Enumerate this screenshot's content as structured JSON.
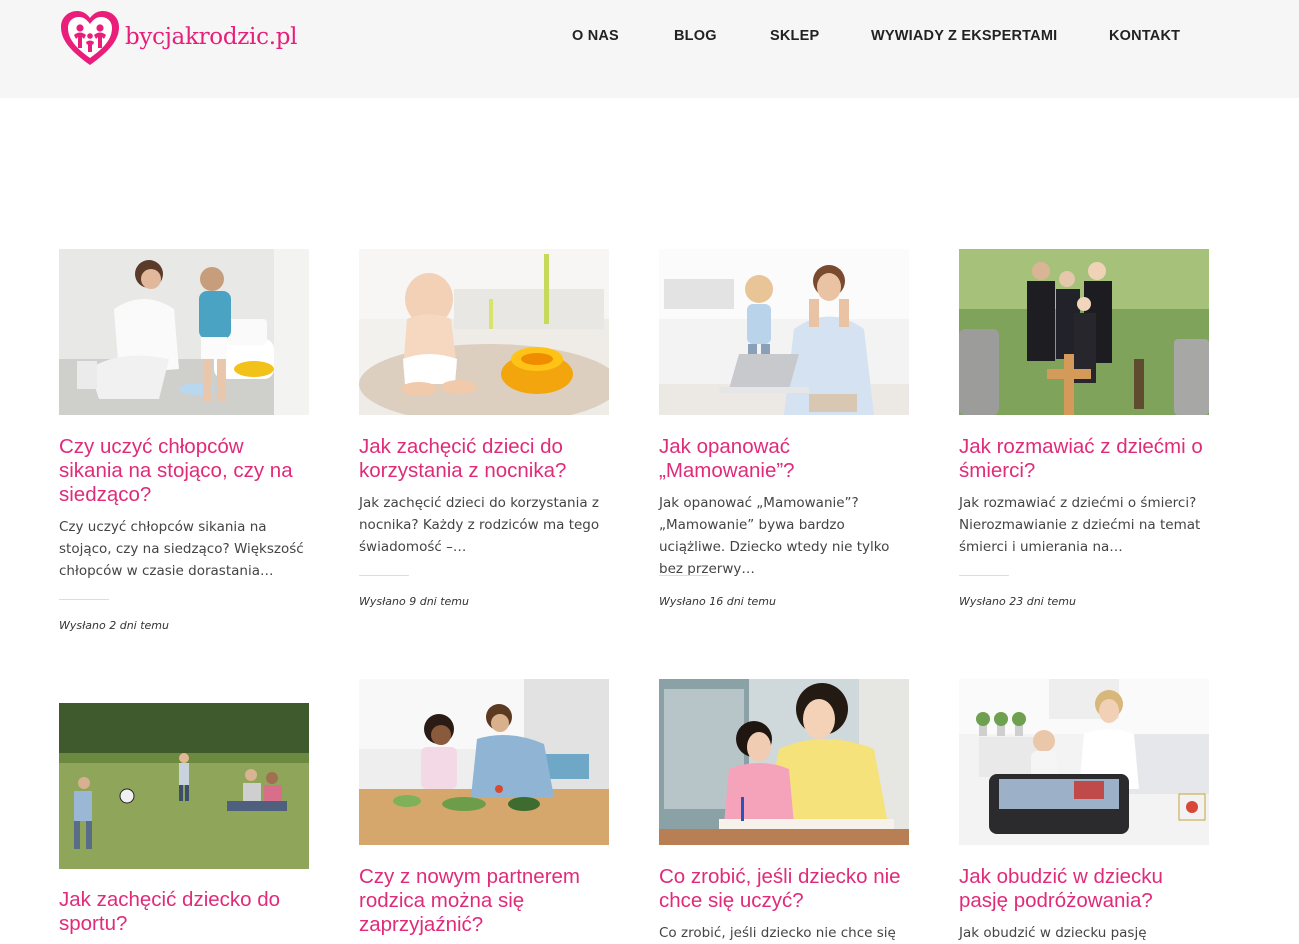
{
  "site": {
    "logo_text": "bycjakrodzic.pl",
    "brand_color": "#e02b7a"
  },
  "nav": [
    "O NAS",
    "BLOG",
    "SKLEP",
    "WYWIADY Z EKSPERTAMI",
    "KONTAKT"
  ],
  "posts": [
    {
      "title": "Czy uczyć chłopców sikania na stojąco, czy na siedząco?",
      "excerpt": "Czy uczyć chłopców sikania na stojąco, czy na siedząco? Większość chłopców w czasie dorastania…",
      "date": "Wysłano 2 dni temu",
      "image": "mother-and-toddler-at-toilet"
    },
    {
      "title": "Jak zachęcić dzieci do korzystania z nocnika?",
      "excerpt": "Jak zachęcić dzieci do korzystania z nocnika? Każdy z rodziców ma tego świadomość –…",
      "date": "Wysłano 9 dni temu",
      "image": "baby-with-yellow-potty"
    },
    {
      "title": "Jak opanować „Mamowanie”?",
      "excerpt": "Jak opanować „Mamowanie”? „Mamowanie” bywa bardzo uciążliwe. Dziecko wtedy nie tylko bez przerwy…",
      "date": "Wysłano 16 dni temu",
      "image": "stressed-mother-at-laptop"
    },
    {
      "title": "Jak rozmawiać z dziećmi o śmierci?",
      "excerpt": "Jak rozmawiać z dziećmi o śmierci? Nierozmawianie z dziećmi na temat śmierci i umierania na…",
      "date": "Wysłano 23 dni temu",
      "image": "family-at-cemetery"
    },
    {
      "title": "Jak zachęcić dziecko do sportu?",
      "excerpt": "",
      "date": "",
      "image": "family-playing-football"
    },
    {
      "title": "Czy z nowym partnerem rodzica można się zaprzyjaźnić?",
      "excerpt": "",
      "date": "",
      "image": "man-and-child-cooking"
    },
    {
      "title": "Co zrobić, jeśli dziecko nie chce się uczyć?",
      "excerpt": "Co zrobić, jeśli dziecko nie chce się",
      "date": "",
      "image": "mother-and-daughter-studying"
    },
    {
      "title": "Jak obudzić w dziecku pasję podróżowania?",
      "excerpt": "Jak obudzić w dziecku pasję",
      "date": "",
      "image": "mother-and-baby-packing-suitcase"
    }
  ]
}
